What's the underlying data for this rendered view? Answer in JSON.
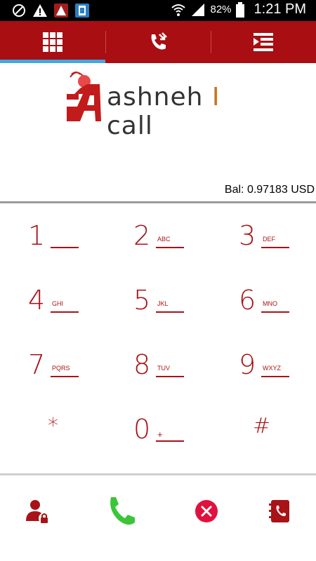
{
  "status_bar": {
    "battery_percent": "82%",
    "time": "1:21 PM"
  },
  "tabs": [
    {
      "name": "dialpad",
      "icon": "grid-icon",
      "active": true
    },
    {
      "name": "call-log",
      "icon": "phone-arrows-icon",
      "active": false
    },
    {
      "name": "menu",
      "icon": "list-icon",
      "active": false
    }
  ],
  "logo": {
    "text_main": "ashneh",
    "text_sep": "I",
    "text_tail": "call"
  },
  "balance": "Bal: 0.97183 USD",
  "keypad": [
    {
      "digit": "1",
      "letters": ""
    },
    {
      "digit": "2",
      "letters": "ABC"
    },
    {
      "digit": "3",
      "letters": "DEF"
    },
    {
      "digit": "4",
      "letters": "GHI"
    },
    {
      "digit": "5",
      "letters": "JKL"
    },
    {
      "digit": "6",
      "letters": "MNO"
    },
    {
      "digit": "7",
      "letters": "PQRS"
    },
    {
      "digit": "8",
      "letters": "TUV"
    },
    {
      "digit": "9",
      "letters": "WXYZ"
    },
    {
      "digit": "*",
      "letters": ""
    },
    {
      "digit": "0",
      "letters": "+"
    },
    {
      "digit": "#",
      "letters": ""
    }
  ],
  "actions": [
    {
      "name": "account-lock",
      "icon": "user-lock-icon"
    },
    {
      "name": "call",
      "icon": "phone-icon"
    },
    {
      "name": "delete",
      "icon": "close-circle-icon"
    },
    {
      "name": "contacts",
      "icon": "contacts-book-icon"
    }
  ],
  "colors": {
    "brand_red": "#a80e12",
    "tab_indicator": "#3fa9e1",
    "call_green": "#3cc43a",
    "delete_red": "#e0113d"
  }
}
